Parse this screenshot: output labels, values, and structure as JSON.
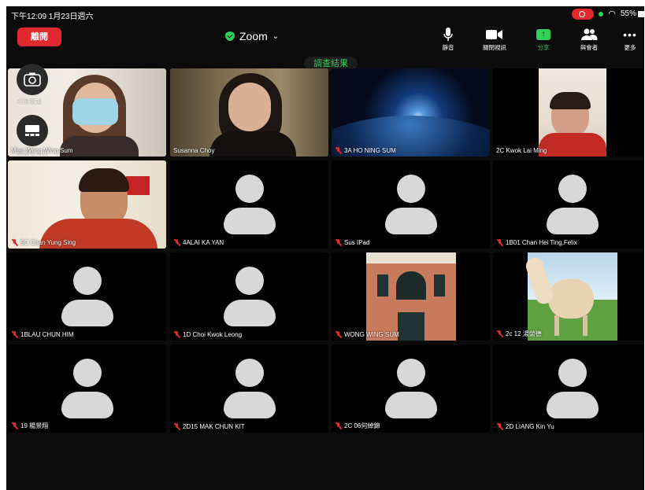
{
  "status_bar": {
    "time": "下午12:09  1月23日週六",
    "battery": "55%"
  },
  "toolbar": {
    "leave_label": "離開",
    "title": "Zoom",
    "mute_label": "靜音",
    "video_label": "關閉視訊",
    "share_label": "分享",
    "participants_label": "與會者",
    "more_label": "更多"
  },
  "poll_banner": "調查結果",
  "floating": {
    "switch_camera_label": "切換鏡頭",
    "gallery_label": "演講者畫面"
  },
  "participants": [
    {
      "name": "Miss Wong Wing Sum",
      "muted": false,
      "active": false
    },
    {
      "name": "Susanna Choy",
      "muted": false,
      "active": true
    },
    {
      "name": "3A HO NING SUM",
      "muted": true,
      "active": false
    },
    {
      "name": "2C Kwok Lai Ming",
      "muted": false,
      "active": false
    },
    {
      "name": "5C Chan Yung Sing",
      "muted": true,
      "active": false
    },
    {
      "name": "4ALAI KA YAN",
      "muted": true,
      "active": false
    },
    {
      "name": "Sus IPad",
      "muted": true,
      "active": false
    },
    {
      "name": "1B01 Chan Hei Ting,Felix",
      "muted": true,
      "active": false
    },
    {
      "name": "1BLAU CHUN HIM",
      "muted": true,
      "active": false
    },
    {
      "name": "1D Choi Kwok Leong",
      "muted": true,
      "active": false
    },
    {
      "name": "WONG WING SUM",
      "muted": true,
      "active": false
    },
    {
      "name": "2c 12 湯榮德",
      "muted": true,
      "active": false
    },
    {
      "name": "19 楊景翔",
      "muted": true,
      "active": false
    },
    {
      "name": "2D15 MAK CHUN KIT",
      "muted": true,
      "active": false
    },
    {
      "name": "2C 06何綽錦",
      "muted": true,
      "active": false
    },
    {
      "name": "2D LIANG Kin Yu",
      "muted": true,
      "active": false
    }
  ],
  "colors": {
    "accent_green": "#2fd158",
    "leave_red": "#e0282e",
    "background": "#0b0b0b"
  }
}
